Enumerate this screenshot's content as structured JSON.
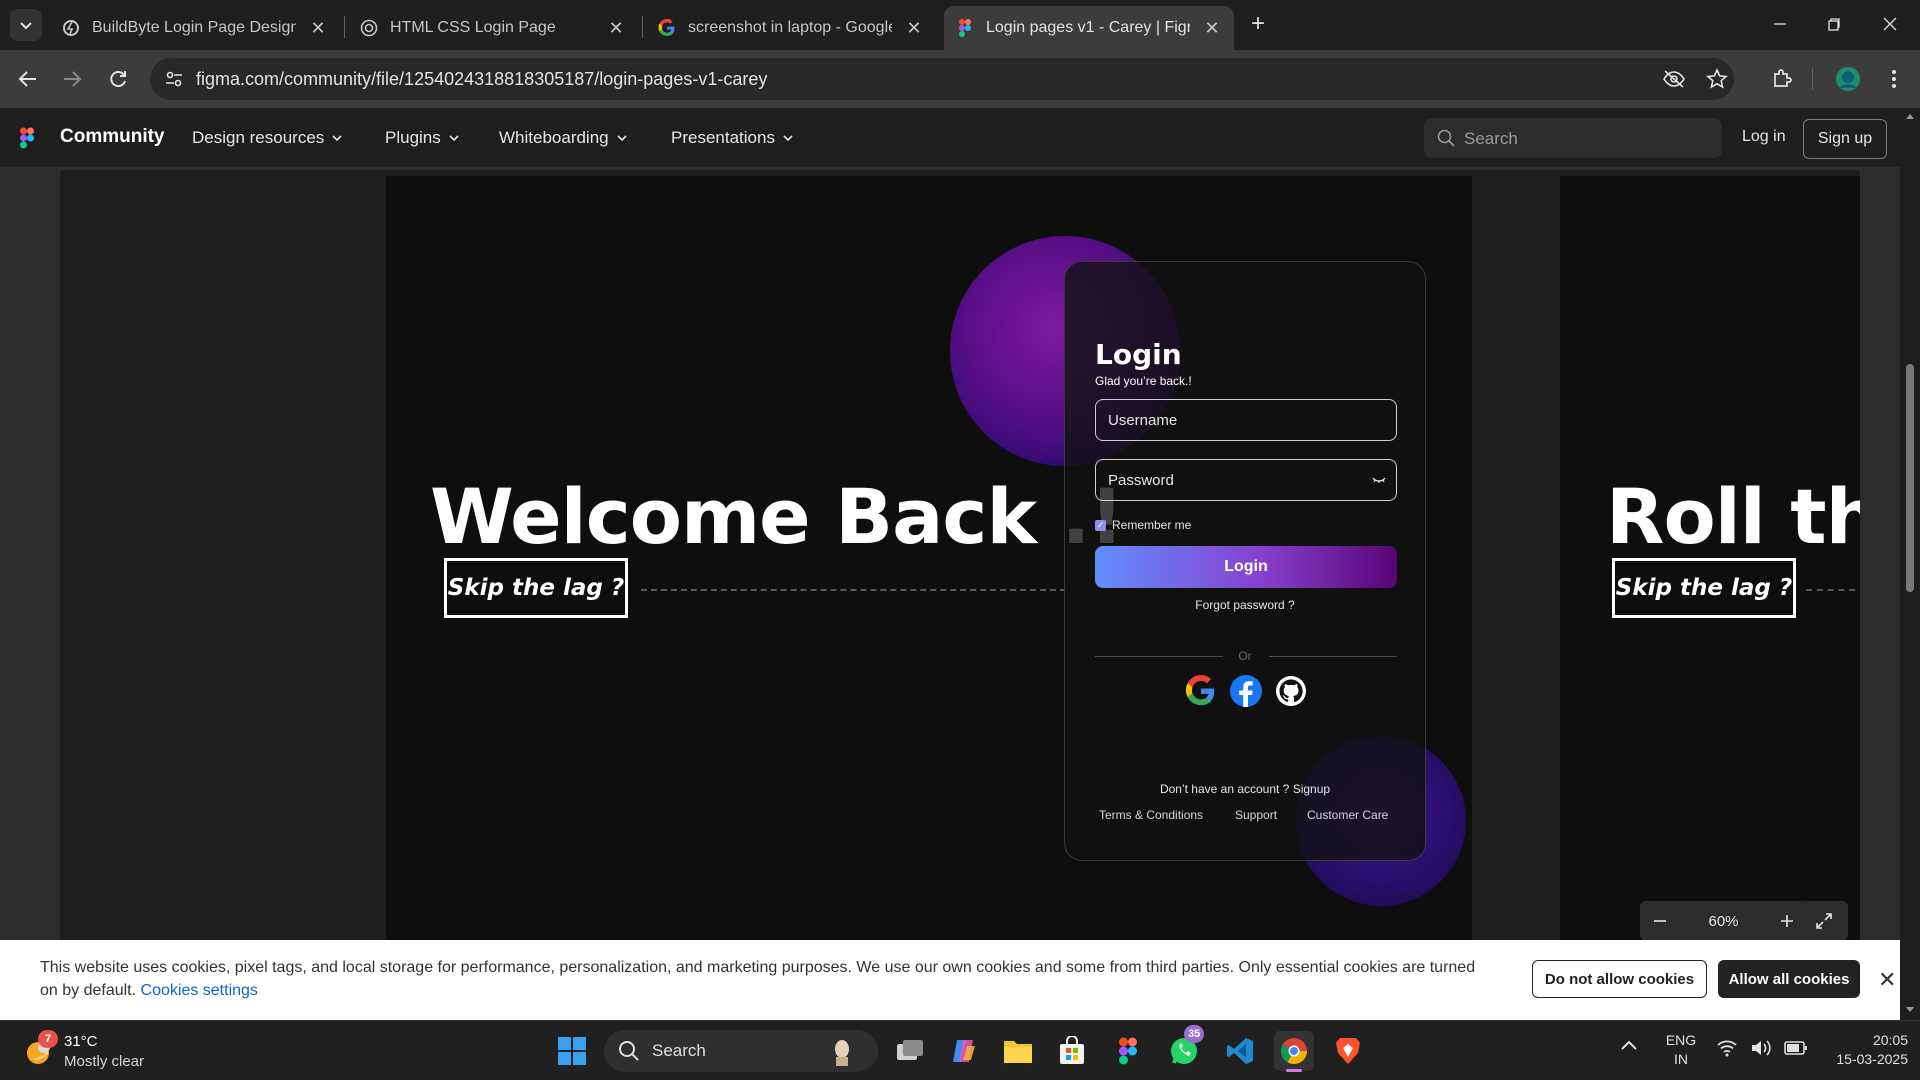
{
  "browser": {
    "tabs": [
      {
        "title": "BuildByte Login Page Design - C",
        "icon": "figma-bolt-icon",
        "active": false
      },
      {
        "title": "HTML CSS Login Page",
        "icon": "openai-icon",
        "active": false
      },
      {
        "title": "screenshot in laptop - Google S",
        "icon": "google-icon",
        "active": false
      },
      {
        "title": "Login pages v1 - Carey | Figma",
        "icon": "figma-icon",
        "active": true
      }
    ],
    "url": "figma.com/community/file/1254024318818305187/login-pages-v1-carey"
  },
  "figma_header": {
    "brand": "Community",
    "nav": [
      "Design resources",
      "Plugins",
      "Whiteboarding",
      "Presentations"
    ],
    "search_placeholder": "Search",
    "login": "Log in",
    "signup": "Sign up"
  },
  "preview": {
    "welcome": "Welcome Back .!",
    "skip": "Skip the lag ?",
    "next_welcome": "Roll the",
    "next_skip": "Skip the lag ?",
    "card": {
      "title": "Login",
      "subtitle": "Glad you’re back.!",
      "username_placeholder": "Username",
      "password_placeholder": "Password",
      "remember": "Remember me",
      "login_button": "Login",
      "forgot": "Forgot password ?",
      "or": "Or",
      "no_account": "Don’t have an account ? Signup",
      "footer_links": [
        "Terms & Conditions",
        "Support",
        "Customer Care"
      ]
    },
    "zoom": "60%"
  },
  "cookie_banner": {
    "text": "This website uses cookies, pixel tags, and local storage for performance, personalization, and marketing purposes. We use our own cookies and some from third parties. Only essential cookies are turned on by default.",
    "settings_link": "Cookies settings",
    "deny": "Do not allow cookies",
    "allow": "Allow all cookies"
  },
  "taskbar": {
    "weather_temp": "31°C",
    "weather_desc": "Mostly clear",
    "weather_badge": "7",
    "search": "Search",
    "whatsapp_badge": "35",
    "lang": "ENG",
    "region": "IN",
    "time": "20:05",
    "date": "15-03-2025"
  },
  "colors": {
    "login_gradient_start": "#628eff",
    "login_gradient_mid": "#8740cd",
    "login_gradient_end": "#580475",
    "glow_purple": "#7b1aa0"
  }
}
